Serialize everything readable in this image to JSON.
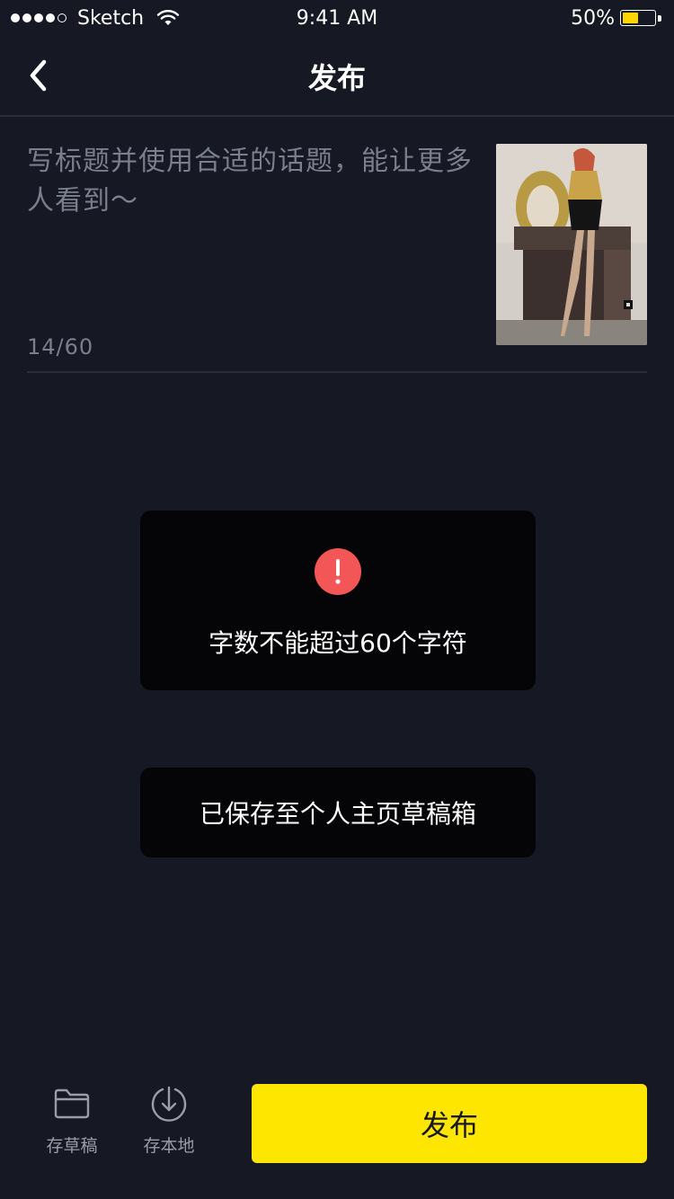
{
  "status_bar": {
    "carrier": "Sketch",
    "time": "9:41 AM",
    "battery_percent": "50%",
    "battery_level": 0.5,
    "signal_bars_filled": 4,
    "signal_bars_total": 5,
    "battery_color": "#ffd400"
  },
  "nav": {
    "back_icon": "chevron-left-icon",
    "title": "发布"
  },
  "composer": {
    "placeholder": "写标题并使用合适的话题，能让更多人看到～",
    "char_count": "14/60",
    "thumbnail": "cover-thumbnail"
  },
  "toasts": {
    "error_icon": "exclamation-circle-icon",
    "error_color": "#f25656",
    "error_message": "字数不能超过60个字符",
    "saved_message": "已保存至个人主页草稿箱"
  },
  "bottom_bar": {
    "save_draft": {
      "icon": "folder-icon",
      "label": "存草稿"
    },
    "save_local": {
      "icon": "download-icon",
      "label": "存本地"
    },
    "publish_label": "发布",
    "publish_color": "#ffe600"
  }
}
